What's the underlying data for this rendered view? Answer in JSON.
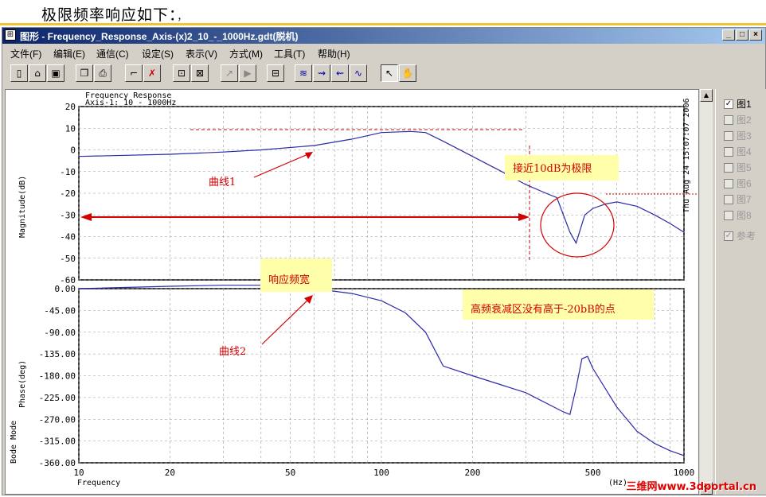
{
  "caption": "极限频率响应如下：",
  "caption_suffix": "，",
  "window": {
    "title": "图形 - Frequency_Response_Axis-(x)2_10_-_1000Hz.gdt(脱机)",
    "minimize": "_",
    "restore": "□",
    "close": "×"
  },
  "menu": [
    "文件(F)",
    "编辑(E)",
    "通信(C)",
    "设定(S)",
    "表示(V)",
    "方式(M)",
    "工具(T)",
    "帮助(H)"
  ],
  "toolbar_icons": [
    "new-file-icon",
    "open-folder-icon",
    "save-icon",
    "copy-icon",
    "print-icon",
    "graph-icon",
    "delete-graph-icon",
    "settings-icon",
    "settings2-icon",
    "trace-icon",
    "play-icon",
    "zoom-fit-icon",
    "wave1-icon",
    "wave2-icon",
    "wave3-icon",
    "wave4-icon",
    "pointer-icon",
    "hand-icon"
  ],
  "plot": {
    "header_line1": "Frequency Response",
    "header_line2": "Axis-1: 10 - 1000Hz",
    "timestamp": "Thu Aug 24 15:07:07 2006",
    "mag_ylabel": "Magnitude(dB)",
    "phase_ylabel": "Phase(deg)",
    "bode_label": "Bode Mode",
    "xlabel": "Frequency",
    "xunit": "(Hz)",
    "mag_ticks": [
      "20",
      "10",
      "0",
      "-10",
      "-20",
      "-30",
      "-40",
      "-50",
      "-60"
    ],
    "phase_ticks": [
      "0.00",
      "-45.00",
      "-90.00",
      "-135.00",
      "-180.00",
      "-225.00",
      "-270.00",
      "-315.00",
      "-360.00"
    ],
    "x_ticks": [
      "10",
      "20",
      "50",
      "100",
      "200",
      "500",
      "1000"
    ]
  },
  "chart_data": [
    {
      "type": "line",
      "title": "Frequency Response",
      "subtitle": "Axis-1: 10 - 1000Hz",
      "xlabel": "Frequency (Hz)",
      "ylabel": "Magnitude(dB)",
      "xscale": "log",
      "xlim": [
        10,
        1000
      ],
      "ylim": [
        -60,
        20
      ],
      "series": [
        {
          "x": [
            10,
            20,
            30,
            40,
            60,
            80,
            100,
            125,
            140,
            160,
            200,
            250,
            300,
            350,
            380,
            420,
            440,
            470,
            500,
            550,
            600,
            700,
            800,
            900,
            1000
          ],
          "y": [
            -3,
            -2,
            -1,
            0,
            2,
            5,
            8,
            8.5,
            8,
            4,
            -3,
            -10,
            -16,
            -20,
            -22,
            -38,
            -43,
            -30,
            -27,
            -25,
            -24,
            -26,
            -30,
            -34,
            -38
          ]
        }
      ]
    },
    {
      "type": "line",
      "xlabel": "Frequency (Hz)",
      "ylabel": "Phase(deg)",
      "xscale": "log",
      "xlim": [
        10,
        1000
      ],
      "ylim": [
        -360,
        0
      ],
      "series": [
        {
          "x": [
            10,
            20,
            30,
            40,
            50,
            60,
            80,
            100,
            120,
            140,
            160,
            200,
            300,
            400,
            420,
            440,
            460,
            480,
            500,
            600,
            700,
            800,
            900,
            1000
          ],
          "y": [
            0,
            5,
            7,
            7,
            5,
            0,
            -10,
            -25,
            -50,
            -90,
            -160,
            -180,
            -215,
            -255,
            -260,
            -205,
            -145,
            -140,
            -165,
            -245,
            -295,
            -320,
            -335,
            -345
          ]
        }
      ]
    }
  ],
  "annotations": {
    "curve1": "曲线1",
    "curve2": "曲线2",
    "limit_note": "接近10dB为极限",
    "bandwidth": "响应频宽",
    "attenuation": "高频衰减区没有高于-20bB的点"
  },
  "legend": [
    {
      "label": "图1",
      "checked": true,
      "enabled": true
    },
    {
      "label": "图2",
      "checked": false,
      "enabled": false
    },
    {
      "label": "图3",
      "checked": false,
      "enabled": false
    },
    {
      "label": "图4",
      "checked": false,
      "enabled": false
    },
    {
      "label": "图5",
      "checked": false,
      "enabled": false
    },
    {
      "label": "图6",
      "checked": false,
      "enabled": false
    },
    {
      "label": "图7",
      "checked": false,
      "enabled": false
    },
    {
      "label": "图8",
      "checked": false,
      "enabled": false
    },
    {
      "label": "参考",
      "checked": true,
      "enabled": false
    }
  ],
  "watermark": "三维网www.3dportal.cn",
  "colors": {
    "curve": "#2a2aa8",
    "annotation": "#d40000",
    "highlight": "#ffffaa",
    "titlebar": "#0a246a"
  }
}
